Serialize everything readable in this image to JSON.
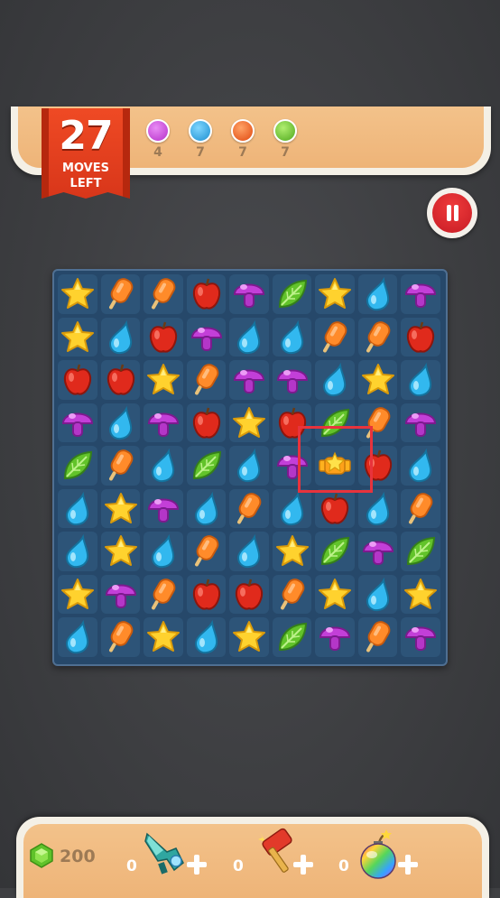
{
  "moves": {
    "count": "27",
    "label_line1": "MOVES",
    "label_line2": "LEFT"
  },
  "goals": [
    {
      "color": "#c63fd6",
      "count": "4"
    },
    {
      "color": "#2aa8e6",
      "count": "7"
    },
    {
      "color": "#f05b1a",
      "count": "7"
    },
    {
      "color": "#63c22a",
      "count": "7"
    }
  ],
  "board": {
    "rows": [
      [
        "star",
        "popsicle",
        "popsicle",
        "apple",
        "mushroom",
        "leaf",
        "star",
        "drop",
        "mushroom"
      ],
      [
        "star",
        "drop",
        "apple",
        "mushroom",
        "drop",
        "drop",
        "popsicle",
        "popsicle",
        "apple"
      ],
      [
        "apple",
        "apple",
        "star",
        "popsicle",
        "mushroom",
        "mushroom",
        "drop",
        "star",
        "drop"
      ],
      [
        "mushroom",
        "drop",
        "mushroom",
        "apple",
        "star",
        "apple",
        "leaf",
        "popsicle",
        "mushroom"
      ],
      [
        "leaf",
        "popsicle",
        "drop",
        "leaf",
        "drop",
        "mushroom",
        "special-popsicle",
        "apple",
        "drop"
      ],
      [
        "drop",
        "star",
        "mushroom",
        "drop",
        "popsicle",
        "drop",
        "apple",
        "drop",
        "popsicle"
      ],
      [
        "drop",
        "star",
        "drop",
        "popsicle",
        "drop",
        "star",
        "leaf",
        "mushroom",
        "leaf"
      ],
      [
        "star",
        "mushroom",
        "popsicle",
        "apple",
        "apple",
        "popsicle",
        "star",
        "drop",
        "star"
      ],
      [
        "drop",
        "popsicle",
        "star",
        "drop",
        "star",
        "leaf",
        "mushroom",
        "popsicle",
        "mushroom"
      ]
    ],
    "selected_cell": "special-popsicle"
  },
  "currency": {
    "icon": "gem-icon",
    "amount": "200"
  },
  "boosters": [
    {
      "icon": "freeze-gun-icon",
      "count": "0"
    },
    {
      "icon": "hammer-icon",
      "count": "0"
    },
    {
      "icon": "rainbow-bomb-icon",
      "count": "0"
    }
  ]
}
